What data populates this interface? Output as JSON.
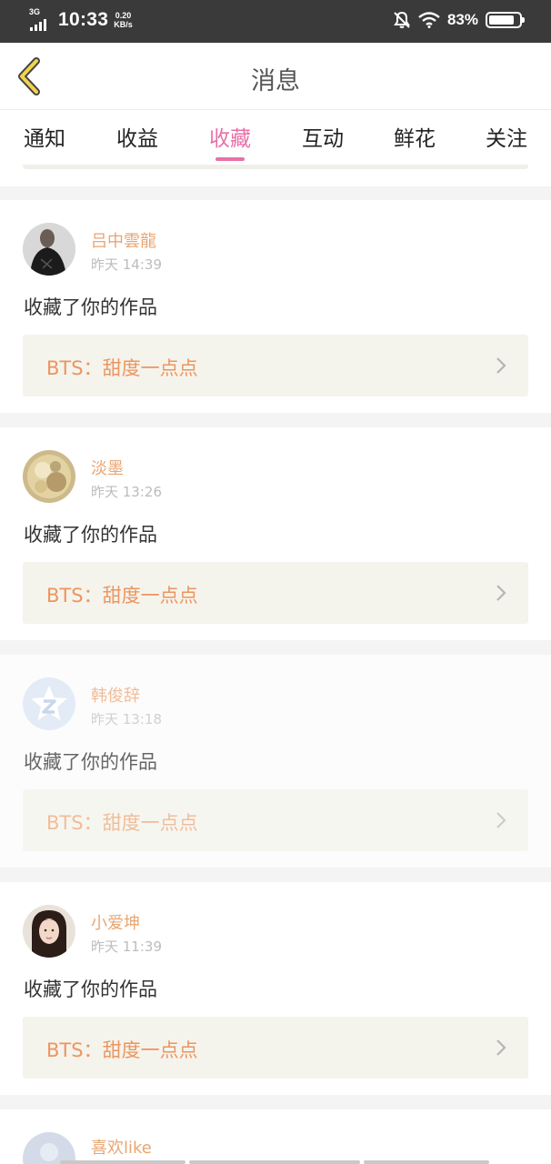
{
  "status_bar": {
    "network": "3G",
    "time": "10:33",
    "speed_value": "0.20",
    "speed_unit": "KB/s",
    "battery": "83%",
    "battery_level": 0.83
  },
  "header": {
    "title": "消息"
  },
  "tabs": [
    {
      "label": "通知",
      "active": false
    },
    {
      "label": "收益",
      "active": false
    },
    {
      "label": "收藏",
      "active": true
    },
    {
      "label": "互动",
      "active": false
    },
    {
      "label": "鲜花",
      "active": false
    },
    {
      "label": "关注",
      "active": false
    }
  ],
  "colors": {
    "accent": "#e870a8",
    "username": "#e8a673",
    "work_title": "#ec9560",
    "work_bg": "#f5f4ec"
  },
  "messages": [
    {
      "user": "吕中雲龍",
      "time": "昨天 14:39",
      "action": "收藏了你的作品",
      "work": "BTS：甜度一点点",
      "avatar": "man-photo-avatar"
    },
    {
      "user": "淡墨",
      "time": "昨天 13:26",
      "action": "收藏了你的作品",
      "work": "BTS：甜度一点点",
      "avatar": "flower-photo-avatar"
    },
    {
      "user": "韩俊辞",
      "time": "昨天 13:18",
      "action": "收藏了你的作品",
      "work": "BTS：甜度一点点",
      "avatar": "default-star-avatar"
    },
    {
      "user": "小爱坤",
      "time": "昨天 11:39",
      "action": "收藏了你的作品",
      "work": "BTS：甜度一点点",
      "avatar": "girl-photo-avatar"
    },
    {
      "user": "喜欢like",
      "avatar": "default-avatar"
    }
  ]
}
